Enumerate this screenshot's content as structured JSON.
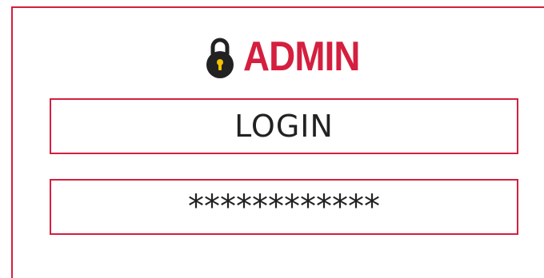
{
  "header": {
    "title": "ADMIN",
    "icon": "lock-icon",
    "accent_color": "#d41f3f"
  },
  "form": {
    "login_value": "LOGIN",
    "password_value": "************"
  }
}
